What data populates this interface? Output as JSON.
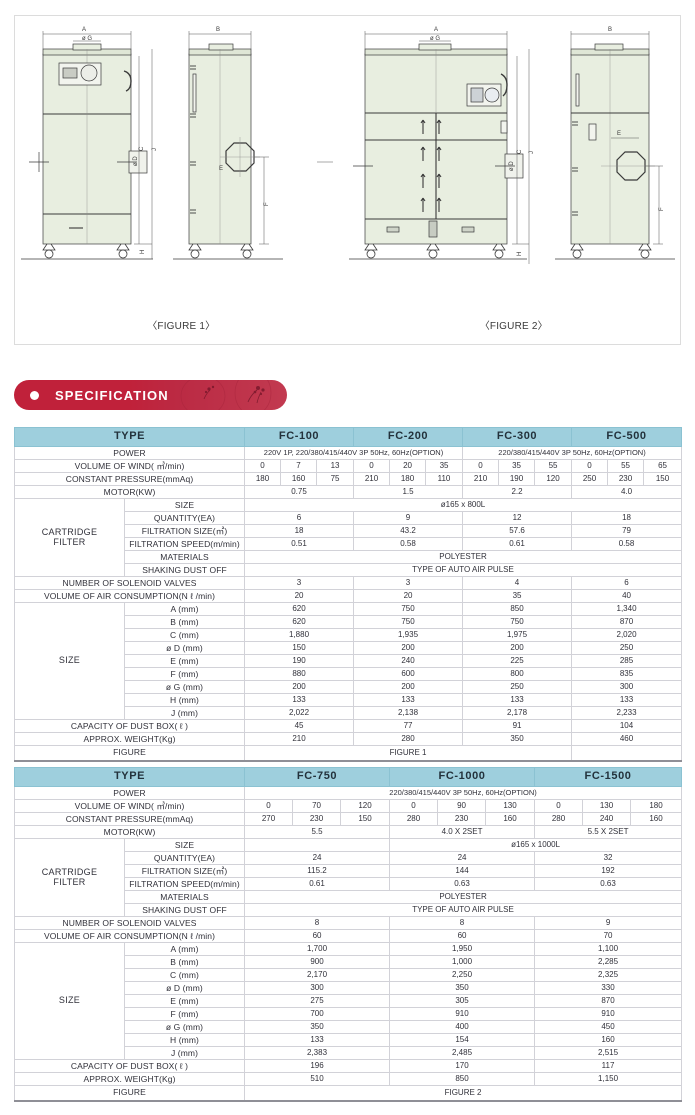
{
  "figures": {
    "fig1_caption": "〈FIGURE 1〉",
    "fig2_caption": "〈FIGURE 2〉",
    "dim_labels": [
      "A",
      "B",
      "C",
      "E",
      "F",
      "H",
      "J",
      "ø G",
      "ø D"
    ]
  },
  "banner": {
    "title": "SPECIFICATION",
    "dot_icon": "bullet-dot-icon",
    "color": "#c0213a"
  },
  "common": {
    "row_labels": {
      "type": "TYPE",
      "power": "POWER",
      "volume_of_wind": "VOLUME OF WIND( ㎥/min)",
      "constant_pressure": "CONSTANT PRESSURE(mmAq)",
      "motor": "MOTOR(KW)",
      "cartridge": "CARTRIDGE",
      "filter": "FILTER",
      "size": "SIZE",
      "quantity": "QUANTITY(EA)",
      "filtration_size": "FILTRATION SIZE(㎡)",
      "filtration_speed": "FILTRATION SPEED(m/min)",
      "materials": "MATERIALS",
      "shaking_dust_off": "SHAKING DUST OFF",
      "solenoid_valves": "NUMBER OF SOLENOID VALVES",
      "air_consumption": "VOLUME OF AIR CONSUMPTION(N ℓ /min)",
      "size_group": "SIZE",
      "a_mm": "A (mm)",
      "b_mm": "B (mm)",
      "c_mm": "C (mm)",
      "d_mm": "ø D (mm)",
      "e_mm": "E (mm)",
      "f_mm": "F (mm)",
      "g_mm": "ø G (mm)",
      "h_mm": "H (mm)",
      "j_mm": "J (mm)",
      "dust_box": "CAPACITY OF DUST BOX( ℓ )",
      "weight": "APPROX. WEIGHT(Kg)",
      "figure": "FIGURE"
    },
    "materials_value": "POLYESTER",
    "shaking_value": "TYPE OF AUTO AIR PULSE"
  },
  "table1": {
    "models": [
      "FC-100",
      "FC-200",
      "FC-300",
      "FC-500"
    ],
    "power_left": "220V 1P, 220/380/415/440V 3P 50Hz, 60Hz(OPTION)",
    "power_right": "220/380/415/440V 3P 50Hz, 60Hz(OPTION)",
    "volume_of_wind": [
      "0",
      "7",
      "13",
      "0",
      "20",
      "35",
      "0",
      "35",
      "55",
      "0",
      "55",
      "65"
    ],
    "constant_pressure": [
      "180",
      "160",
      "75",
      "210",
      "180",
      "110",
      "210",
      "190",
      "120",
      "250",
      "230",
      "150"
    ],
    "motor": [
      "0.75",
      "1.5",
      "2.2",
      "4.0"
    ],
    "cartridge_size": "ø165 x 800L",
    "quantity": [
      "6",
      "9",
      "12",
      "18"
    ],
    "filtration_size": [
      "18",
      "43.2",
      "57.6",
      "79"
    ],
    "filtration_speed": [
      "0.51",
      "0.58",
      "0.61",
      "0.58"
    ],
    "solenoid_valves": [
      "3",
      "3",
      "4",
      "6"
    ],
    "air_consumption": [
      "20",
      "20",
      "35",
      "40"
    ],
    "a_mm": [
      "620",
      "750",
      "850",
      "1,340"
    ],
    "b_mm": [
      "620",
      "750",
      "750",
      "870"
    ],
    "c_mm": [
      "1,880",
      "1,935",
      "1,975",
      "2,020"
    ],
    "d_mm": [
      "150",
      "200",
      "200",
      "250"
    ],
    "e_mm": [
      "190",
      "240",
      "225",
      "285"
    ],
    "f_mm": [
      "880",
      "600",
      "800",
      "835"
    ],
    "g_mm": [
      "200",
      "200",
      "250",
      "300"
    ],
    "h_mm": [
      "133",
      "133",
      "133",
      "133"
    ],
    "j_mm": [
      "2,022",
      "2,138",
      "2,178",
      "2,233"
    ],
    "dust_box": [
      "45",
      "77",
      "91",
      "104"
    ],
    "weight": [
      "210",
      "280",
      "350",
      "460"
    ],
    "figure": "FIGURE 1"
  },
  "table2": {
    "models": [
      "FC-750",
      "FC-1000",
      "FC-1500"
    ],
    "power": "220/380/415/440V 3P 50Hz, 60Hz(OPTION)",
    "volume_of_wind": [
      "0",
      "70",
      "120",
      "0",
      "90",
      "130",
      "0",
      "130",
      "180"
    ],
    "constant_pressure": [
      "270",
      "230",
      "150",
      "280",
      "230",
      "160",
      "280",
      "240",
      "160"
    ],
    "motor": [
      "5.5",
      "4.0 X 2SET",
      "5.5 X 2SET"
    ],
    "cartridge_size": "ø165 x 1000L",
    "quantity": [
      "24",
      "24",
      "32"
    ],
    "filtration_size": [
      "115.2",
      "144",
      "192"
    ],
    "filtration_speed": [
      "0.61",
      "0.63",
      "0.63"
    ],
    "solenoid_valves": [
      "8",
      "8",
      "9"
    ],
    "air_consumption": [
      "60",
      "60",
      "70"
    ],
    "a_mm": [
      "1,700",
      "1,950",
      "1,100"
    ],
    "b_mm": [
      "900",
      "1,000",
      "2,285"
    ],
    "c_mm": [
      "2,170",
      "2,250",
      "2,325"
    ],
    "d_mm": [
      "300",
      "350",
      "330"
    ],
    "e_mm": [
      "275",
      "305",
      "870"
    ],
    "f_mm": [
      "700",
      "910",
      "910"
    ],
    "g_mm": [
      "350",
      "400",
      "450"
    ],
    "h_mm": [
      "133",
      "154",
      "160"
    ],
    "j_mm": [
      "2,383",
      "2,485",
      "2,515"
    ],
    "dust_box": [
      "196",
      "170",
      "117"
    ],
    "weight": [
      "510",
      "850",
      "1,150"
    ],
    "figure": "FIGURE 2"
  }
}
